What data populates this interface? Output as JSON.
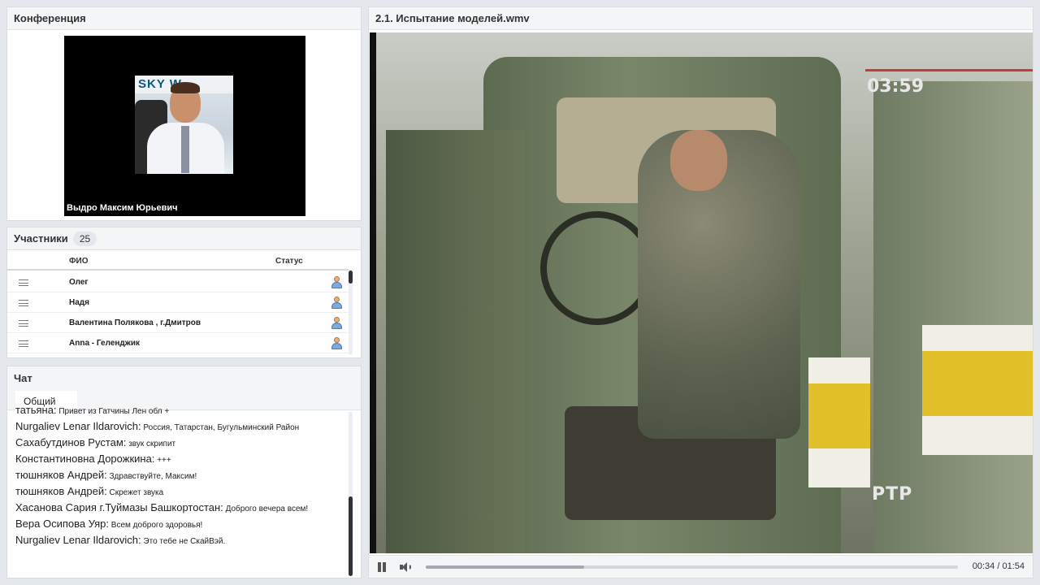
{
  "conference": {
    "title": "Конференция",
    "speaker_name": "Выдро Максим Юрьевич",
    "photo_logo": "SKY W"
  },
  "participants": {
    "title": "Участники",
    "count": "25",
    "col_name": "ФИО",
    "col_status": "Статус",
    "rows": [
      {
        "name": "Олег"
      },
      {
        "name": "Надя"
      },
      {
        "name": "Валентина  Полякова , г.Дмитров"
      },
      {
        "name": "Anna - Геленджик"
      }
    ],
    "scroll_position": 0.0
  },
  "chat": {
    "title": "Чат",
    "tab": "Общий",
    "messages": [
      {
        "author": "татьяна:",
        "text": "Привет из Гатчины Лен обл     +"
      },
      {
        "author": "Nurgaliev Lenar  Ildarovich:",
        "text": "Россия, Татарстан, Бугульминский Район"
      },
      {
        "author": "Сахабутдинов Рустам:",
        "text": "звук скрипит"
      },
      {
        "author": "Константиновна Дорожкина:",
        "text": "+++"
      },
      {
        "author": "тюшняков  Андрей:",
        "text": "Здравствуйте, Максим!"
      },
      {
        "author": "тюшняков  Андрей:",
        "text": "Скрежет звука"
      },
      {
        "author": "Хасанова Сария г.Туймазы Башкортостан:",
        "text": "Доброго вечера всем!"
      },
      {
        "author": "Вера  Осипова Уяр:",
        "text": "Всем доброго здоровья!"
      },
      {
        "author": "Nurgaliev Lenar  Ildarovich:",
        "text": "Это тебе не СкайВэй."
      }
    ],
    "scroll_position": 1.0
  },
  "player": {
    "title": "2.1. Испытание моделей.wmv",
    "overlay_logo": "РТР",
    "overlay_clock": "03:59",
    "current_time": "00:34",
    "duration": "01:54",
    "time_display": "00:34 / 01:54",
    "progress_fraction": 0.298
  },
  "colors": {
    "panel_bg": "#ffffff",
    "header_bg": "#f3f5f7",
    "page_bg": "#e4e7eb",
    "scroll_thumb": "#2f3338"
  }
}
